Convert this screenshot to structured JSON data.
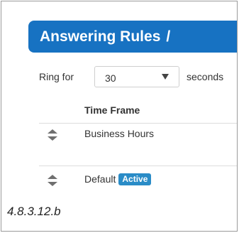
{
  "header": {
    "title": "Answering Rules",
    "separator": "/"
  },
  "ring": {
    "label": "Ring for",
    "selected_value": "30",
    "unit_label": "seconds"
  },
  "table": {
    "column_header": "Time Frame",
    "rows": [
      {
        "label": "Business Hours",
        "badge": ""
      },
      {
        "label": "Default",
        "badge": "Active"
      }
    ]
  },
  "icons": {
    "sort_handle": "sort-up-down-icon",
    "select_caret": "caret-down-icon"
  },
  "colors": {
    "banner_background": "#1772c2",
    "badge_background": "#2a8cc7"
  },
  "caption": "4.8.3.12.b"
}
